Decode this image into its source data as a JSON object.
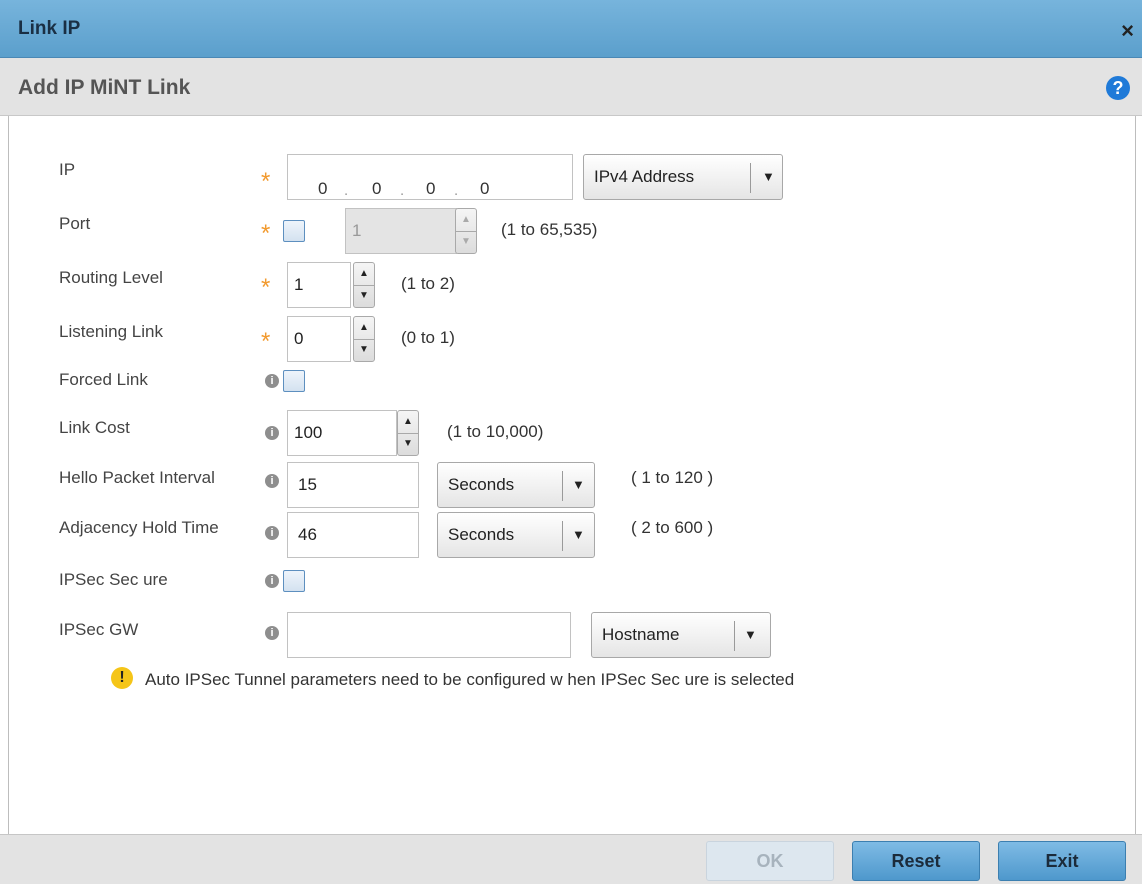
{
  "window": {
    "title": "Link IP",
    "close_label": "×"
  },
  "header": {
    "title": "Add IP MiNT Link",
    "help_label": "?"
  },
  "fields": {
    "ip": {
      "label": "IP",
      "octets": [
        "0",
        "0",
        "0",
        "0"
      ],
      "dot": ".",
      "type_select": "IPv4 Address"
    },
    "port": {
      "label": "Port",
      "value": "1",
      "range": "(1 to 65,535)"
    },
    "routing_level": {
      "label": "Routing Level",
      "value": "1",
      "range": "(1 to 2)"
    },
    "listening_link": {
      "label": "Listening Link",
      "value": "0",
      "range": "(0 to 1)"
    },
    "forced_link": {
      "label": "Forced Link"
    },
    "link_cost": {
      "label": "Link Cost",
      "value": "100",
      "range": "(1 to 10,000)"
    },
    "hello_packet_interval": {
      "label": "Hello Packet Interval",
      "value": "15",
      "unit": "Seconds",
      "range": "( 1 to 120 )"
    },
    "adjacency_hold_time": {
      "label": "Adjacency Hold Time",
      "value": "46",
      "unit": "Seconds",
      "range": "( 2 to 600 )"
    },
    "ipsec_secure": {
      "label": "IPSec Sec ure"
    },
    "ipsec_gw": {
      "label": "IPSec GW",
      "value": "",
      "type_select": "Hostname"
    }
  },
  "warning": {
    "text": "Auto IPSec Tunnel parameters need to be configured w hen IPSec Sec ure is selected",
    "icon_label": "!"
  },
  "icons": {
    "required": "*",
    "info": "i",
    "up": "▲",
    "down": "▼"
  },
  "buttons": {
    "ok": "OK",
    "reset": "Reset",
    "exit": "Exit"
  },
  "colors": {
    "titlebar": "#5b9fcc",
    "required_star": "#f29a2e",
    "help": "#1f7ad8",
    "warning": "#f5c518"
  }
}
